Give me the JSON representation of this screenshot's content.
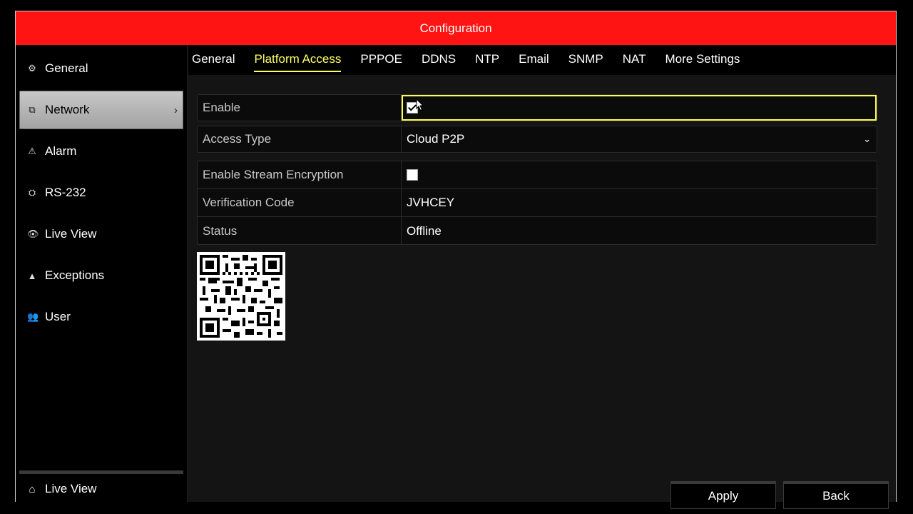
{
  "window": {
    "title": "Configuration"
  },
  "sidebar": {
    "items": [
      {
        "label": "General",
        "icon": "gear-icon",
        "glyph": "⚙"
      },
      {
        "label": "Network",
        "icon": "network-icon",
        "glyph": "⧉",
        "active": true,
        "chevron": "›"
      },
      {
        "label": "Alarm",
        "icon": "alarm-icon",
        "glyph": "⚠"
      },
      {
        "label": "RS-232",
        "icon": "serial-port-icon",
        "glyph": "⛭"
      },
      {
        "label": "Live View",
        "icon": "eye-icon",
        "glyph": "👁"
      },
      {
        "label": "Exceptions",
        "icon": "warning-icon",
        "glyph": "▲"
      },
      {
        "label": "User",
        "icon": "users-icon",
        "glyph": "👥"
      }
    ],
    "bottom": {
      "label": "Live View",
      "icon": "home-icon",
      "glyph": "⌂"
    }
  },
  "tabs": [
    {
      "label": "General"
    },
    {
      "label": "Platform Access",
      "active": true
    },
    {
      "label": "PPPOE"
    },
    {
      "label": "DDNS"
    },
    {
      "label": "NTP"
    },
    {
      "label": "Email"
    },
    {
      "label": "SNMP"
    },
    {
      "label": "NAT"
    },
    {
      "label": "More Settings"
    }
  ],
  "form": {
    "enable": {
      "label": "Enable",
      "checked": true
    },
    "access_type": {
      "label": "Access Type",
      "value": "Cloud P2P",
      "arrow": "⌄"
    },
    "stream_encryption": {
      "label": "Enable Stream Encryption",
      "checked": false
    },
    "verification_code": {
      "label": "Verification Code",
      "value": "JVHCEY"
    },
    "status": {
      "label": "Status",
      "value": "Offline"
    }
  },
  "buttons": {
    "apply": "Apply",
    "back": "Back"
  },
  "colors": {
    "title_bar": "#ff1414",
    "active_tab": "#ffff66",
    "focus": "#ffff55"
  }
}
